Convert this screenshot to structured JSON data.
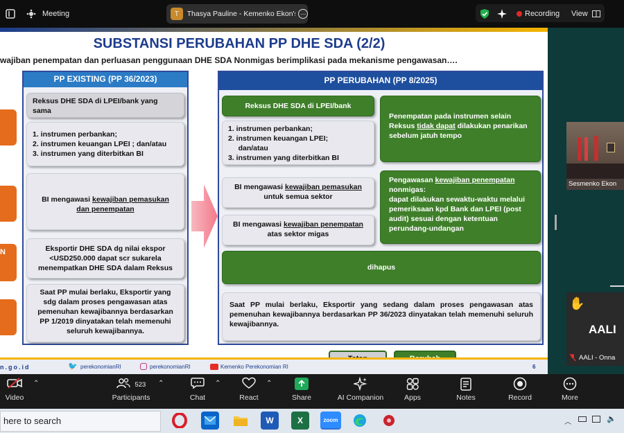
{
  "topbar": {
    "meeting_label": "Meeting",
    "window_title": "Thasya Pauline - Kemenko Ekon's",
    "recording_label": "Recording",
    "view_label": "View"
  },
  "slide": {
    "title": "SUBSTANSI PERUBAHAN PP DHE SDA (2/2)",
    "subtitle": "wajiban penempatan dan perluasan penggunaan DHE SDA Nonmigas berimplikasi pada mekanisme pengawasan….",
    "left_panel": {
      "header": "PP EXISTING (PP 36/2023)",
      "box1": "Reksus DHE SDA di LPEI/bank yang sama",
      "box2_lines": [
        "1.  instrumen perbankan;",
        "2.  instrumen keuangan LPEI ; dan/atau",
        "3.  instrumen yang diterbitkan BI"
      ],
      "box3_pre": "BI mengawasi ",
      "box3_ul": "kewajiban pemasukan",
      "box3_post": "dan penempatan",
      "box4": "Eksportir DHE SDA dg nilai ekspor <USD250.000 dapat scr sukarela menempatkan DHE SDA dalam Reksus",
      "box5": "Saat PP mulai berlaku, Eksportir yang sdg dalam proses pengawasan atas pemenuhan kewajibannya berdasarkan PP 1/2019 dinyatakan telah memenuhi seluruh kewajibannya."
    },
    "right_panel": {
      "header": "PP PERUBAHAN (PP 8/2025)",
      "green1": "Reksus DHE SDA di LPEI/bank",
      "list_lines": [
        "1.  instrumen perbankan;",
        "2.  instrumen keuangan LPEI;",
        "     dan/atau",
        "3.  instrumen yang diterbitkan BI"
      ],
      "box_a_pre": "BI mengawasi ",
      "box_a_ul": "kewajiban pemasukan",
      "box_a_post": "untuk semua sektor",
      "box_b_pre": "BI mengawasi ",
      "box_b_ul": "kewajiban penempatan",
      "box_b_post": "atas sektor migas",
      "green2_pre": "Penempatan pada instrumen selain Reksus ",
      "green2_ul": "tidak dapat",
      "green2_post": " dilakukan penarikan sebelum jatuh tempo",
      "green3_pre": "Pengawasan ",
      "green3_ul": "kewajiban penempatan",
      "green3_post1": " nonmigas:",
      "green3_post2": "dapat dilakukan sewaktu-waktu melalui pemeriksaan kpd Bank dan LPEI (post audit) sesuai dengan ketentuan perundang-undangan",
      "green4": "dihapus",
      "box_final": "Saat PP mulai berlaku, Eksportir yang sedang dalam proses pengawasan atas pemenuhan kewajibannya berdasarkan PP 36/2023 dinyatakan telah memenuhi seluruh kewajibannya."
    },
    "legend": {
      "tetap": "Tetap",
      "berubah": "Berubah"
    },
    "footer": {
      "site": "n.go.id",
      "twitter": "perekonomianRI",
      "instagram": "perekonomianRI",
      "youtube": "Kemenko Perekonomian RI",
      "page": "6"
    }
  },
  "participants": {
    "video_name": "Sesmenko Ekon",
    "aali_initials": "AALI",
    "aali_name": "AALI - Onna"
  },
  "toolbar": {
    "video": "Video",
    "participants": "Participants",
    "participants_count": "523",
    "chat": "Chat",
    "react": "React",
    "share": "Share",
    "ai": "AI Companion",
    "apps": "Apps",
    "notes": "Notes",
    "record": "Record",
    "more": "More"
  },
  "taskbar": {
    "search_text": "here to search",
    "zoom_label": "zoom"
  },
  "colors": {
    "accent_blue": "#1c3c8c",
    "green": "#3f7f2a",
    "orange": "#e46c1c"
  }
}
